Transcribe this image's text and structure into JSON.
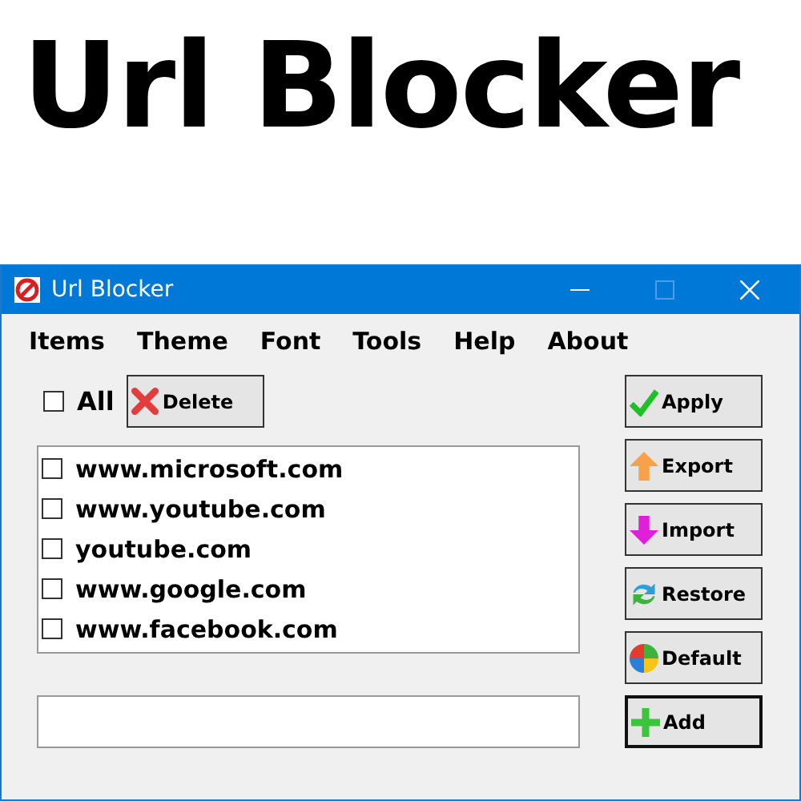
{
  "heading": "Url Blocker",
  "window": {
    "title": "Url Blocker"
  },
  "menu": [
    "Items",
    "Theme",
    "Font",
    "Tools",
    "Help",
    "About"
  ],
  "select_all": {
    "label": "All",
    "checked": false
  },
  "delete_button": "Delete",
  "urls": [
    {
      "label": "www.microsoft.com",
      "checked": false
    },
    {
      "label": "www.youtube.com",
      "checked": false
    },
    {
      "label": "youtube.com",
      "checked": false
    },
    {
      "label": "www.google.com",
      "checked": false
    },
    {
      "label": "www.facebook.com",
      "checked": false
    }
  ],
  "buttons": [
    {
      "label": "Apply",
      "kind": "check",
      "default": false
    },
    {
      "label": "Export",
      "kind": "up",
      "default": false
    },
    {
      "label": "Import",
      "kind": "down",
      "default": false
    },
    {
      "label": "Restore",
      "kind": "refresh",
      "default": false
    },
    {
      "label": "Default",
      "kind": "colors",
      "default": false
    },
    {
      "label": "Add",
      "kind": "plus",
      "default": true
    }
  ]
}
